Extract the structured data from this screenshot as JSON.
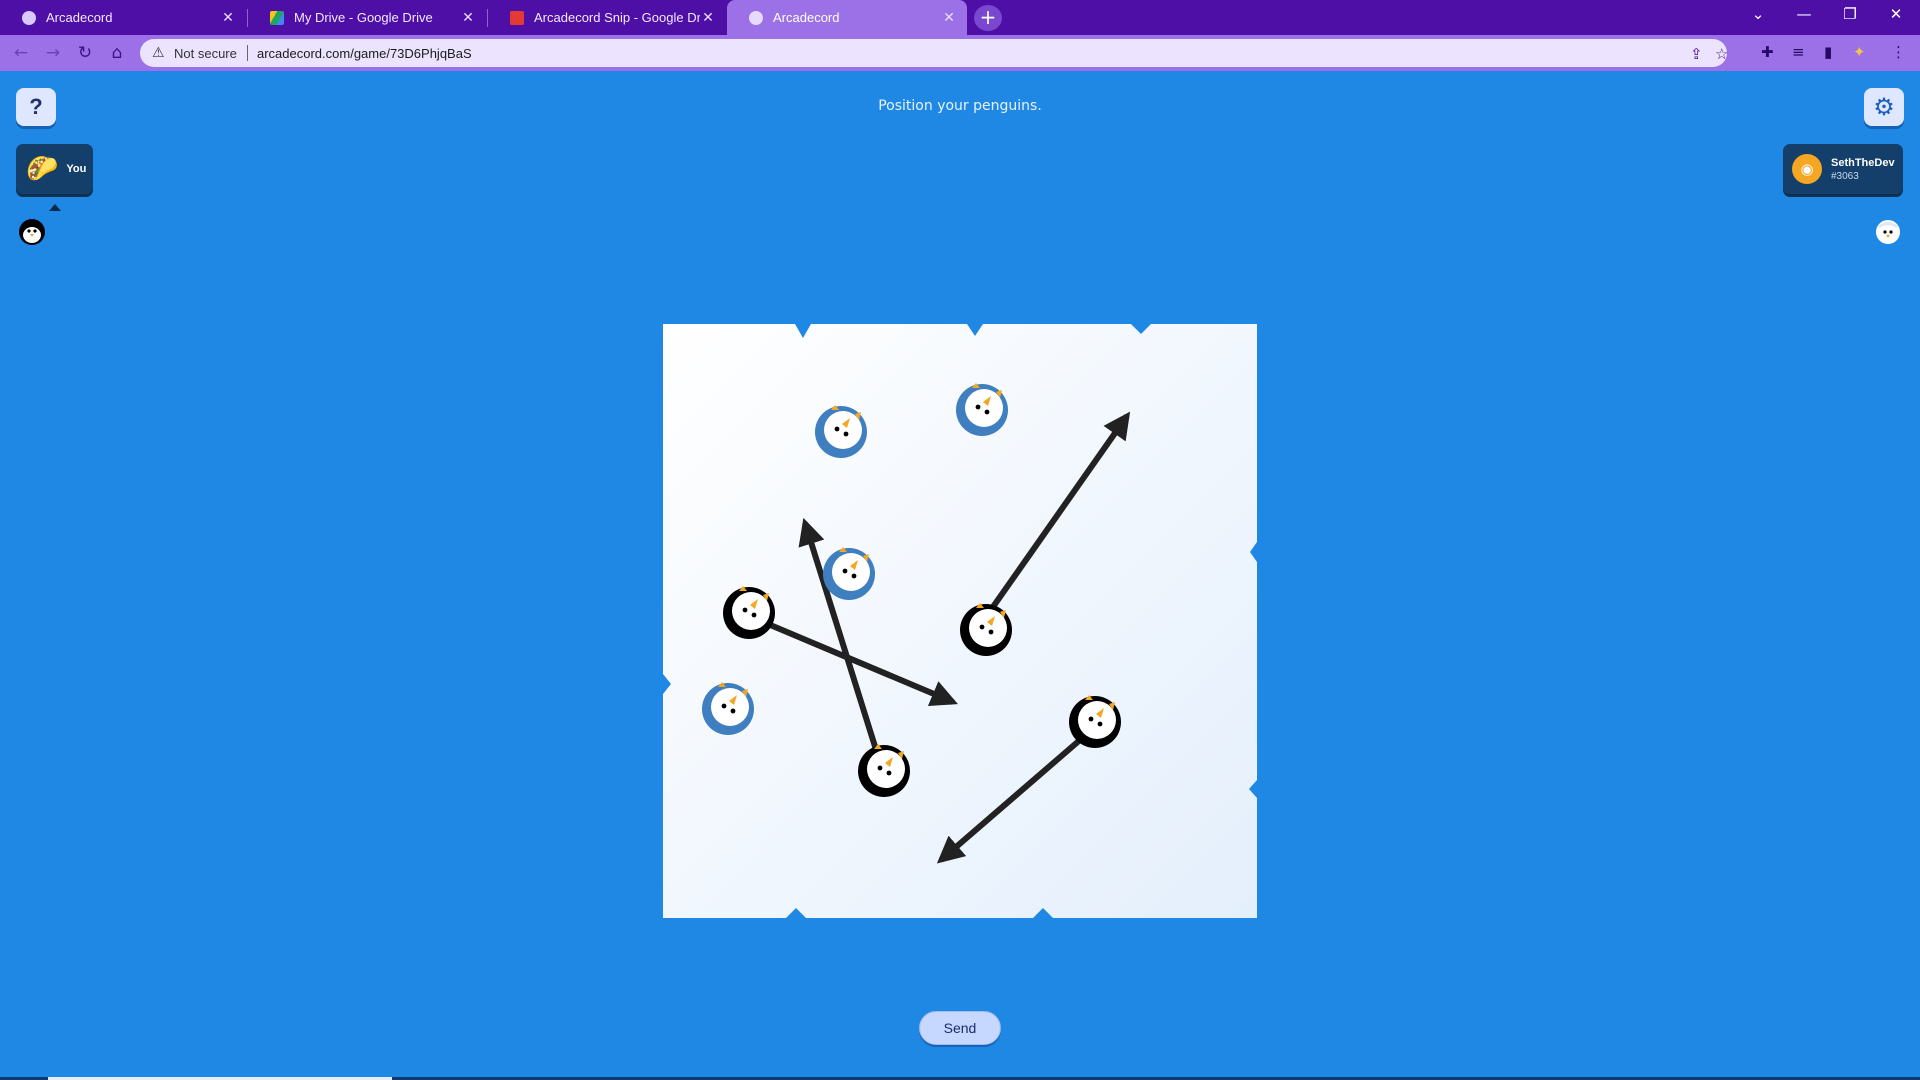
{
  "browser": {
    "tabs": [
      {
        "title": "Arcadecord",
        "favicon": "arcadecord-icon",
        "active": false
      },
      {
        "title": "My Drive - Google Drive",
        "favicon": "google-drive-icon",
        "active": false
      },
      {
        "title": "Arcadecord Snip - Google Drawin",
        "favicon": "google-drawings-icon",
        "active": false
      },
      {
        "title": "Arcadecord",
        "favicon": "arcadecord-icon",
        "active": true
      }
    ],
    "security_label": "Not secure",
    "url": "arcadecord.com/game/73D6PhjqBaS"
  },
  "game": {
    "prompt": "Position your penguins.",
    "help_label": "?",
    "send_label": "Send",
    "you": {
      "label": "You",
      "avatar": "taco-icon"
    },
    "opponent": {
      "name": "SethTheDev",
      "discriminator": "#3063",
      "avatar": "discord-icon"
    },
    "colors": {
      "background": "#1f88e5",
      "ice": "#f4f8fe",
      "your_penguin": "#000000",
      "opponent_penguin": "#3f7fbf",
      "arrow": "#222222"
    }
  }
}
